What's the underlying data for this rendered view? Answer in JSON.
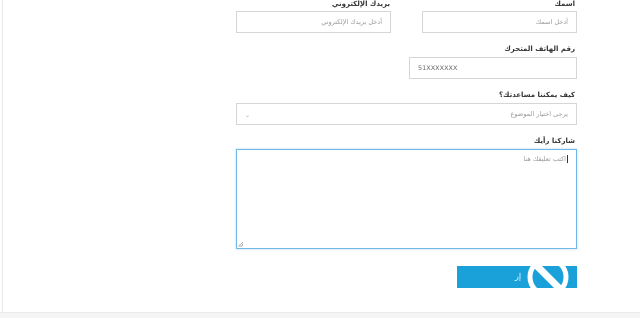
{
  "form": {
    "name_label": "اسمك",
    "name_placeholder": "أدخل اسمك",
    "email_label": "بريدك الإلكتروني",
    "email_placeholder": "أدخل بريدك الإلكتروني",
    "phone_label": "رقم الهاتف المتحرك",
    "phone_value": "51XXXXXXX",
    "topic_label": "كيف يمكننا مساعدتك؟",
    "topic_placeholder": "يرجى اختيار الموضوع",
    "comment_label": "شاركنا رأيك",
    "comment_placeholder": "اكتب تعليقك هنا",
    "submit_label": "إر"
  },
  "colors": {
    "accent": "#1ba1d9",
    "focus_border": "#6fb8e8"
  },
  "icons": {
    "topic_select": "chevron-down-icon",
    "submit_overlay": "loading-spinner-icon"
  }
}
